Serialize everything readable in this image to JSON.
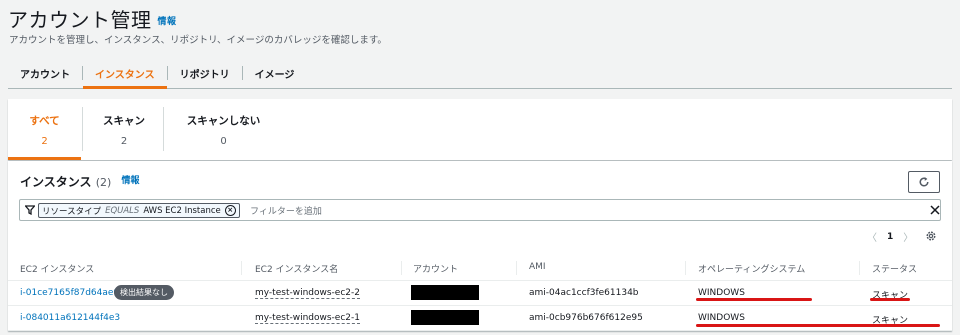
{
  "header": {
    "title": "アカウント管理",
    "info": "情報",
    "description": "アカウントを管理し、インスタンス、リポジトリ、イメージのカバレッジを確認します。"
  },
  "tabs": [
    {
      "label": "アカウント",
      "active": false
    },
    {
      "label": "インスタンス",
      "active": true
    },
    {
      "label": "リポジトリ",
      "active": false
    },
    {
      "label": "イメージ",
      "active": false
    }
  ],
  "summary": [
    {
      "label": "すべて",
      "count": "2",
      "active": true
    },
    {
      "label": "スキャン",
      "count": "2",
      "active": false
    },
    {
      "label": "スキャンしない",
      "count": "0",
      "active": false
    }
  ],
  "table": {
    "title": "インスタンス",
    "count": "(2)",
    "info": "情報",
    "filter": {
      "key": "リソースタイプ",
      "operator": "EQUALS",
      "value": "AWS EC2 Instance",
      "placeholder": "フィルターを追加"
    },
    "pager": {
      "prev": "〈",
      "page": "1",
      "next": "〉"
    },
    "columns": [
      "EC2 インスタンス",
      "EC2 インスタンス名",
      "アカウント",
      "AMI",
      "オペレーティングシステム",
      "ステータス"
    ],
    "rows": [
      {
        "instance": "i-01ce7165f87d64ae0",
        "badge": "検出結果なし",
        "name": "my-test-windows-ec2-2",
        "ami": "ami-04ac1ccf3fe61134b",
        "os": "WINDOWS",
        "status": "スキャン"
      },
      {
        "instance": "i-084011a612144f4e3",
        "badge": "",
        "name": "my-test-windows-ec2-1",
        "ami": "ami-0cb976b676f612e95",
        "os": "WINDOWS",
        "status": "スキャン"
      }
    ]
  },
  "colors": {
    "accent": "#ec7211",
    "link": "#0073bb",
    "annotation": "#d91515"
  }
}
